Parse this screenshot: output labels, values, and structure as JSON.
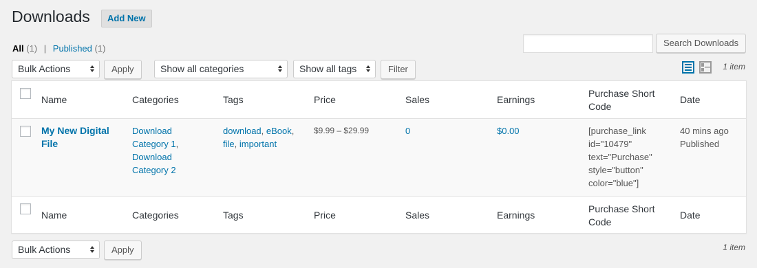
{
  "header": {
    "title": "Downloads",
    "add_new_label": "Add New"
  },
  "views": {
    "all_label": "All",
    "all_count": "(1)",
    "separator": "|",
    "published_label": "Published",
    "published_count": "(1)"
  },
  "search": {
    "value": "",
    "button_label": "Search Downloads"
  },
  "top_nav": {
    "bulk_actions": "Bulk Actions",
    "apply_label": "Apply",
    "categories_filter": "Show all categories",
    "tags_filter": "Show all tags",
    "filter_label": "Filter",
    "item_count": "1 item"
  },
  "bottom_nav": {
    "bulk_actions": "Bulk Actions",
    "apply_label": "Apply",
    "item_count": "1 item"
  },
  "columns": {
    "name": "Name",
    "categories": "Categories",
    "tags": "Tags",
    "price": "Price",
    "sales": "Sales",
    "earnings": "Earnings",
    "shortcode_1": "Purchase Short",
    "shortcode_2": "Code",
    "date": "Date"
  },
  "row": {
    "title_1": "My New Digital",
    "title_2": "File",
    "cat1_a": "Download",
    "cat1_b": "Category 1",
    "comma": ",",
    "cat2_a": "Download",
    "cat2_b": "Category 2",
    "tag1": "download",
    "tag2": "eBook",
    "tag3": "file",
    "tag4": "important",
    "price": "$9.99 – $29.99",
    "sales": "0",
    "earnings": "$0.00",
    "shortcode": [
      "[purchase_link",
      "id=\"10479\"",
      "text=\"Purchase\"",
      "style=\"button\"",
      "color=\"blue\"]"
    ],
    "date": "40 mins ago",
    "status": "Published"
  },
  "colors": {
    "link": "#0073aa",
    "list_view_active": "#0073aa",
    "excerpt_view": "#999999"
  },
  "icons": {
    "list_view": "list-view-icon",
    "excerpt_view": "excerpt-view-icon"
  }
}
